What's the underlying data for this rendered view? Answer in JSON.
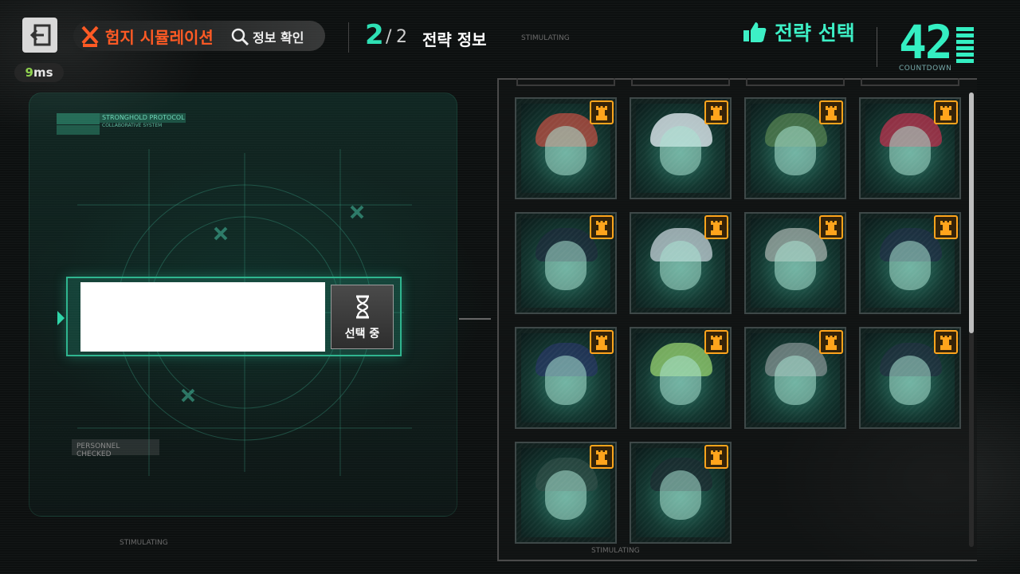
{
  "header": {
    "ping_value": "9",
    "ping_unit": "ms",
    "mode_title": "험지 시뮬레이션",
    "info_button_label": "정보 확인",
    "page_current": "2",
    "page_separator": "/",
    "page_total": "2",
    "section_title": "전략 정보",
    "select_title": "전략 선택",
    "countdown_value": "42",
    "countdown_label": "COUNTDOWN"
  },
  "left_panel": {
    "protocol_line1": "STRONGHOLD PROTOCOL",
    "protocol_line2": "COLLABORATIVE SYSTEM",
    "personnel_tag": "PERSONNEL CHECKED",
    "slot_button_label": "선택 중"
  },
  "decor": {
    "stim_top": "STIMULATING",
    "stim_left": "STIMULATING",
    "stim_bottom": "STIMULATING"
  },
  "colors": {
    "accent_teal": "#2ee0b4",
    "mode_orange": "#ff5a24",
    "badge_orange": "#ffa41c"
  },
  "icons": {
    "exit": "exit-door-icon",
    "mode": "crossed-swords-icon",
    "info": "search-icon",
    "select": "thumbs-up-icon",
    "slot": "hourglass-icon",
    "badge": "rook-tower-icon"
  },
  "scroll": {
    "visible_fraction": 0.53
  },
  "cards": [
    {
      "hair": "#b24a3e"
    },
    {
      "hair": "#dfe7ee"
    },
    {
      "hair": "#4f7a4c"
    },
    {
      "hair": "#b0304a"
    },
    {
      "hair": "#1c2a3a"
    },
    {
      "hair": "#b8c6cc"
    },
    {
      "hair": "#9aa8a2"
    },
    {
      "hair": "#1e2e44"
    },
    {
      "hair": "#24345e"
    },
    {
      "hair": "#8ec86a"
    },
    {
      "hair": "#7a8a8a"
    },
    {
      "hair": "#1f2f3e"
    },
    {
      "hair": "#2c4a44"
    },
    {
      "hair": "#1a2a30"
    }
  ]
}
